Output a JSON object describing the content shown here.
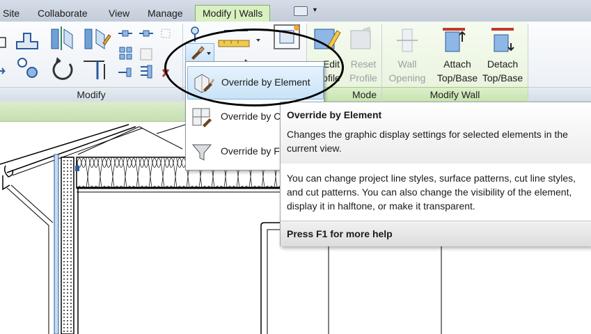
{
  "tabs": [
    {
      "label": "Site"
    },
    {
      "label": "Collaborate"
    },
    {
      "label": "View"
    },
    {
      "label": "Manage"
    },
    {
      "label": "Modify | Walls",
      "active": true
    }
  ],
  "ribbon": {
    "panels": {
      "modify": "Modify",
      "mode": "Mode",
      "modify_wall": "Modify Wall"
    },
    "buttons": {
      "edit_profile": {
        "line1": "Edit",
        "line2": "ofile"
      },
      "reset_profile": {
        "line1": "Reset",
        "line2": "Profile"
      },
      "wall_opening": {
        "line1": "Wall",
        "line2": "Opening"
      },
      "attach_top_base": {
        "line1": "Attach",
        "line2": "Top/Base"
      },
      "detach_top_base": {
        "line1": "Detach",
        "line2": "Top/Base"
      }
    }
  },
  "menu": {
    "items": [
      {
        "label": "Override by Element",
        "highlighted": true
      },
      {
        "label": "Override by C",
        "highlighted": false
      },
      {
        "label": "Override by F",
        "highlighted": false
      }
    ]
  },
  "tooltip": {
    "title": "Override by Element",
    "description": "Changes the graphic display settings for selected elements in the current view.",
    "body": "You can change project line styles, surface patterns, cut line styles, and cut patterns. You can also change the visibility of the element, display it in halftone, or make it transparent.",
    "help": "Press F1 for more help"
  },
  "colors": {
    "active_tab": "#d9f0c2",
    "highlight": "#c9e3f8",
    "panel_green": "#c7e2ad"
  },
  "icons": [
    "brush-icon",
    "paint-override-icon",
    "filter-icon",
    "lock-icon",
    "mirror-icon",
    "rotate-icon",
    "move-icon",
    "align-icon",
    "measure-icon"
  ]
}
